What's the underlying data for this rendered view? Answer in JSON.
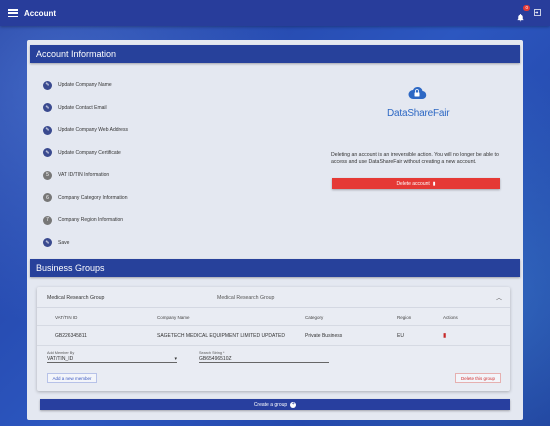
{
  "app": {
    "title": "Account",
    "notification_count": "0"
  },
  "account_info": {
    "header": "Account Information",
    "steps": [
      {
        "label": "Update Company Name",
        "marker": "✎"
      },
      {
        "label": "Update Contact Email",
        "marker": "✎"
      },
      {
        "label": "Update Company Web Address",
        "marker": "✎"
      },
      {
        "label": "Update Company Certificate",
        "marker": "✎"
      },
      {
        "label": "VAT ID/TIN Information",
        "marker": "5"
      },
      {
        "label": "Company Category Information",
        "marker": "6"
      },
      {
        "label": "Company Region Information",
        "marker": "7"
      },
      {
        "label": "Save",
        "marker": "✎"
      }
    ],
    "logo_text": "DataShareFair",
    "delete_message": "Deleting an account is an irreversible action. You will no longer be able to access and use DataShareFair without creating a new account.",
    "delete_button": "Delete account"
  },
  "business_groups": {
    "header": "Business Groups",
    "group": {
      "name": "Medical Research Group",
      "description": "Medical Research Group",
      "columns": [
        "VAT/TIN ID",
        "Company Name",
        "Category",
        "Region",
        "Actions"
      ],
      "rows": [
        [
          "GB226345811",
          "SAGETECH MEDICAL EQUIPMENT LIMITED UPDATED",
          "Private Business",
          "EU"
        ]
      ],
      "add_member_by_label": "Add Member By",
      "add_member_by_value": "VAT/TIN_ID",
      "search_label": "Search String *",
      "search_value": "GB65496510Z",
      "add_member_button": "Add a new member",
      "delete_group_button": "Delete this group"
    },
    "create_group_button": "Create a group"
  },
  "colors": {
    "primary": "#283d9b",
    "danger": "#e53935"
  }
}
